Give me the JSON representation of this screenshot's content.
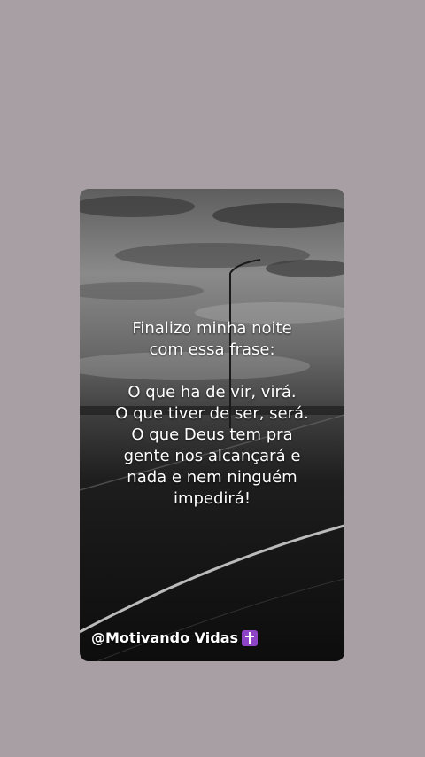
{
  "quote": {
    "line1": "Finalizo minha noite",
    "line2": "com essa frase:",
    "line3": "O que ha de vir, virá.",
    "line4": "O que tiver de ser, será.",
    "line5": "O que Deus tem pra",
    "line6": "gente nos alcançará e",
    "line7": "nada e nem ninguém",
    "line8": "impedirá!"
  },
  "handle": {
    "text": "@Motivando Vidas"
  },
  "icons": {
    "handle_icon": "latin-cross-icon"
  },
  "colors": {
    "page_background": "#a89fa4",
    "icon_background": "#8e44c6"
  }
}
